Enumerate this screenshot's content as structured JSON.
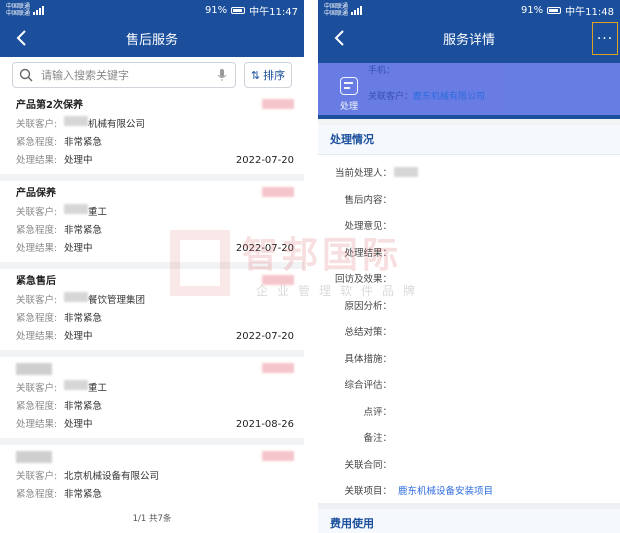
{
  "left": {
    "status": {
      "carrier1": "中国联通",
      "carrier2": "中国联通",
      "battery": "91%",
      "time": "中午11:47"
    },
    "title": "售后服务",
    "search": {
      "placeholder": "请输入搜索关键字"
    },
    "sort_label": "排序",
    "labels": {
      "customer": "关联客户:",
      "urgency": "紧急程度:",
      "result": "处理结果:"
    },
    "cards": [
      {
        "title": "产品第2次保养",
        "customer": "机械有限公司",
        "urgency": "非常紧急",
        "result": "处理中",
        "date": "2022-07-20"
      },
      {
        "title": "产品保养",
        "customer": "重工",
        "urgency": "非常紧急",
        "result": "处理中",
        "date": "2022-07-20"
      },
      {
        "title": "紧急售后",
        "customer": "餐饮管理集团",
        "urgency": "非常紧急",
        "result": "处理中",
        "date": "2022-07-20"
      },
      {
        "title": "",
        "customer": "重工",
        "urgency": "非常紧急",
        "result": "处理中",
        "date": "2021-08-26"
      },
      {
        "title": "",
        "customer": "北京机械设备有限公司",
        "urgency": "非常紧急",
        "result": "",
        "date": ""
      }
    ],
    "pager": "1/1 共7条"
  },
  "right": {
    "status": {
      "carrier1": "中国联通",
      "carrier2": "中国联通",
      "battery": "91%",
      "time": "中午11:48"
    },
    "title": "服务详情",
    "more": "···",
    "header": {
      "phone_label": "手机：",
      "customer_label": "关联客户：",
      "customer_value": "鹿东机械有限公司",
      "process_label": "处理"
    },
    "section_title": "处理情况",
    "rows": [
      {
        "label": "当前处理人：",
        "value": ""
      },
      {
        "label": "售后内容：",
        "value": ""
      },
      {
        "label": "处理意见：",
        "value": ""
      },
      {
        "label": "处理结果：",
        "value": ""
      },
      {
        "label": "回访及效果：",
        "value": ""
      },
      {
        "label": "原因分析：",
        "value": ""
      },
      {
        "label": "总结对策：",
        "value": ""
      },
      {
        "label": "具体措施：",
        "value": ""
      },
      {
        "label": "综合评估：",
        "value": ""
      },
      {
        "label": "点评：",
        "value": ""
      },
      {
        "label": "备注：",
        "value": ""
      },
      {
        "label": "关联合同：",
        "value": ""
      },
      {
        "label": "关联项目：",
        "value": "鹿东机械设备安装项目"
      }
    ],
    "fee_title": "费用使用"
  },
  "watermark": {
    "name": "智邦国际",
    "sub": "企业管理软件品牌"
  },
  "colors": {
    "primary": "#1b4f9c",
    "link": "#2f6de0",
    "header_purple": "#6d7fe8"
  }
}
